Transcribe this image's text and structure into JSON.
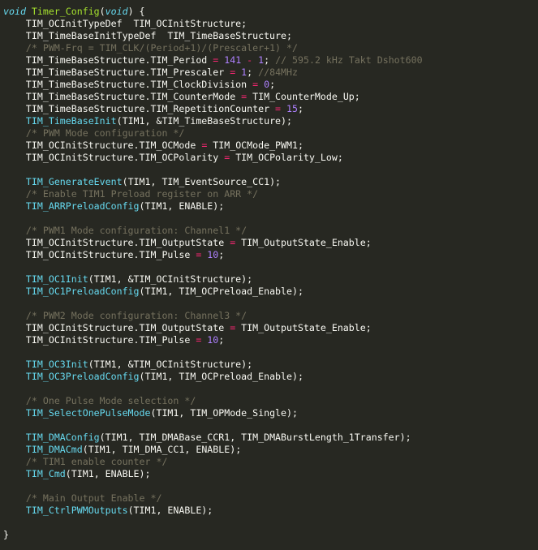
{
  "editor": {
    "theme_colors": {
      "background": "#272822",
      "plain": "#f8f8f2",
      "keyword": "#66d9ef",
      "function_def": "#a6e22e",
      "function_call": "#66d9ef",
      "comment": "#75715e",
      "number": "#ae81ff",
      "operator": "#f92672"
    },
    "lines": [
      [
        [
          "keyword",
          "void"
        ],
        [
          "plain",
          " "
        ],
        [
          "func",
          "Timer_Config"
        ],
        [
          "plain",
          "("
        ],
        [
          "keyword",
          "void"
        ],
        [
          "plain",
          ") {"
        ]
      ],
      [
        [
          "plain",
          "    TIM_OCInitTypeDef  TIM_OCInitStructure;"
        ]
      ],
      [
        [
          "plain",
          "    TIM_TimeBaseInitTypeDef  TIM_TimeBaseStructure;"
        ]
      ],
      [
        [
          "plain",
          "    "
        ],
        [
          "comment",
          "/* PWM-Frq = TIM_CLK/(Period+1)/(Prescaler+1) */"
        ]
      ],
      [
        [
          "plain",
          "    TIM_TimeBaseStructure.TIM_Period "
        ],
        [
          "op",
          "="
        ],
        [
          "plain",
          " "
        ],
        [
          "num",
          "141"
        ],
        [
          "plain",
          " "
        ],
        [
          "op",
          "-"
        ],
        [
          "plain",
          " "
        ],
        [
          "num",
          "1"
        ],
        [
          "plain",
          "; "
        ],
        [
          "comment",
          "// 595.2 kHz Takt Dshot600"
        ]
      ],
      [
        [
          "plain",
          "    TIM_TimeBaseStructure.TIM_Prescaler "
        ],
        [
          "op",
          "="
        ],
        [
          "plain",
          " "
        ],
        [
          "num",
          "1"
        ],
        [
          "plain",
          "; "
        ],
        [
          "comment",
          "//84MHz"
        ]
      ],
      [
        [
          "plain",
          "    TIM_TimeBaseStructure.TIM_ClockDivision "
        ],
        [
          "op",
          "="
        ],
        [
          "plain",
          " "
        ],
        [
          "num",
          "0"
        ],
        [
          "plain",
          ";"
        ]
      ],
      [
        [
          "plain",
          "    TIM_TimeBaseStructure.TIM_CounterMode "
        ],
        [
          "op",
          "="
        ],
        [
          "plain",
          " TIM_CounterMode_Up;"
        ]
      ],
      [
        [
          "plain",
          "    TIM_TimeBaseStructure.TIM_RepetitionCounter "
        ],
        [
          "op",
          "="
        ],
        [
          "plain",
          " "
        ],
        [
          "num",
          "15"
        ],
        [
          "plain",
          ";"
        ]
      ],
      [
        [
          "plain",
          "    "
        ],
        [
          "call",
          "TIM_TimeBaseInit"
        ],
        [
          "plain",
          "(TIM1, &TIM_TimeBaseStructure);"
        ]
      ],
      [
        [
          "plain",
          "    "
        ],
        [
          "comment",
          "/* PWM Mode configuration */"
        ]
      ],
      [
        [
          "plain",
          "    TIM_OCInitStructure.TIM_OCMode "
        ],
        [
          "op",
          "="
        ],
        [
          "plain",
          " TIM_OCMode_PWM1;"
        ]
      ],
      [
        [
          "plain",
          "    TIM_OCInitStructure.TIM_OCPolarity "
        ],
        [
          "op",
          "="
        ],
        [
          "plain",
          " TIM_OCPolarity_Low;"
        ]
      ],
      [
        [
          "plain",
          ""
        ]
      ],
      [
        [
          "plain",
          "    "
        ],
        [
          "call",
          "TIM_GenerateEvent"
        ],
        [
          "plain",
          "(TIM1, TIM_EventSource_CC1);"
        ]
      ],
      [
        [
          "plain",
          "    "
        ],
        [
          "comment",
          "/* Enable TIM1 Preload register on ARR */"
        ]
      ],
      [
        [
          "plain",
          "    "
        ],
        [
          "call",
          "TIM_ARRPreloadConfig"
        ],
        [
          "plain",
          "(TIM1, ENABLE);"
        ]
      ],
      [
        [
          "plain",
          ""
        ]
      ],
      [
        [
          "plain",
          "    "
        ],
        [
          "comment",
          "/* PWM1 Mode configuration: Channel1 */"
        ]
      ],
      [
        [
          "plain",
          "    TIM_OCInitStructure.TIM_OutputState "
        ],
        [
          "op",
          "="
        ],
        [
          "plain",
          " TIM_OutputState_Enable;"
        ]
      ],
      [
        [
          "plain",
          "    TIM_OCInitStructure.TIM_Pulse "
        ],
        [
          "op",
          "="
        ],
        [
          "plain",
          " "
        ],
        [
          "num",
          "10"
        ],
        [
          "plain",
          ";"
        ]
      ],
      [
        [
          "plain",
          ""
        ]
      ],
      [
        [
          "plain",
          "    "
        ],
        [
          "call",
          "TIM_OC1Init"
        ],
        [
          "plain",
          "(TIM1, &TIM_OCInitStructure);"
        ]
      ],
      [
        [
          "plain",
          "    "
        ],
        [
          "call",
          "TIM_OC1PreloadConfig"
        ],
        [
          "plain",
          "(TIM1, TIM_OCPreload_Enable);"
        ]
      ],
      [
        [
          "plain",
          ""
        ]
      ],
      [
        [
          "plain",
          "    "
        ],
        [
          "comment",
          "/* PWM2 Mode configuration: Channel3 */"
        ]
      ],
      [
        [
          "plain",
          "    TIM_OCInitStructure.TIM_OutputState "
        ],
        [
          "op",
          "="
        ],
        [
          "plain",
          " TIM_OutputState_Enable;"
        ]
      ],
      [
        [
          "plain",
          "    TIM_OCInitStructure.TIM_Pulse "
        ],
        [
          "op",
          "="
        ],
        [
          "plain",
          " "
        ],
        [
          "num",
          "10"
        ],
        [
          "plain",
          ";"
        ]
      ],
      [
        [
          "plain",
          ""
        ]
      ],
      [
        [
          "plain",
          "    "
        ],
        [
          "call",
          "TIM_OC3Init"
        ],
        [
          "plain",
          "(TIM1, &TIM_OCInitStructure);"
        ]
      ],
      [
        [
          "plain",
          "    "
        ],
        [
          "call",
          "TIM_OC3PreloadConfig"
        ],
        [
          "plain",
          "(TIM1, TIM_OCPreload_Enable);"
        ]
      ],
      [
        [
          "plain",
          ""
        ]
      ],
      [
        [
          "plain",
          "    "
        ],
        [
          "comment",
          "/* One Pulse Mode selection */"
        ]
      ],
      [
        [
          "plain",
          "    "
        ],
        [
          "call",
          "TIM_SelectOnePulseMode"
        ],
        [
          "plain",
          "(TIM1, TIM_OPMode_Single);"
        ]
      ],
      [
        [
          "plain",
          ""
        ]
      ],
      [
        [
          "plain",
          "    "
        ],
        [
          "call",
          "TIM_DMAConfig"
        ],
        [
          "plain",
          "(TIM1, TIM_DMABase_CCR1, TIM_DMABurstLength_1Transfer);"
        ]
      ],
      [
        [
          "plain",
          "    "
        ],
        [
          "call",
          "TIM_DMACmd"
        ],
        [
          "plain",
          "(TIM1, TIM_DMA_CC1, ENABLE);"
        ]
      ],
      [
        [
          "plain",
          "    "
        ],
        [
          "comment",
          "/* TIM1 enable counter */"
        ]
      ],
      [
        [
          "plain",
          "    "
        ],
        [
          "call",
          "TIM_Cmd"
        ],
        [
          "plain",
          "(TIM1, ENABLE);"
        ]
      ],
      [
        [
          "plain",
          ""
        ]
      ],
      [
        [
          "plain",
          "    "
        ],
        [
          "comment",
          "/* Main Output Enable */"
        ]
      ],
      [
        [
          "plain",
          "    "
        ],
        [
          "call",
          "TIM_CtrlPWMOutputs"
        ],
        [
          "plain",
          "(TIM1, ENABLE);"
        ]
      ],
      [
        [
          "plain",
          ""
        ]
      ],
      [
        [
          "plain",
          "}"
        ]
      ]
    ]
  }
}
